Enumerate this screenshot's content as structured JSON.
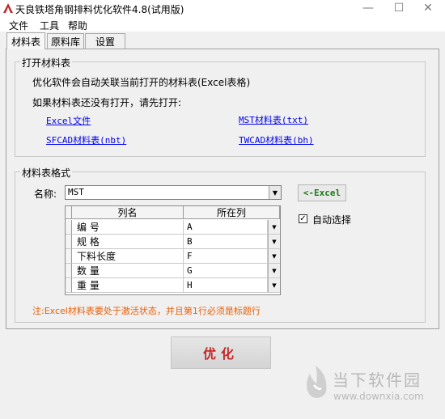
{
  "window": {
    "title": "天良铁塔角钢排料优化软件4.8(试用版)",
    "minimize_glyph": "—",
    "maximize_glyph": "☐",
    "close_glyph": "✕"
  },
  "menu": {
    "file": "文件",
    "tools": "工具",
    "help": "帮助"
  },
  "tabs": [
    {
      "label": "材料表",
      "active": true
    },
    {
      "label": "原料库",
      "active": false
    },
    {
      "label": "设置",
      "active": false
    }
  ],
  "open_group": {
    "title": "打开材料表",
    "description": "优化软件会自动关联当前打开的材料表(Excel表格)",
    "hint": "如果材料表还没有打开，请先打开:",
    "links": {
      "excel": "Excel文件",
      "mst": "MST材料表(txt)",
      "sfcad": "SFCAD材料表(nbt)",
      "twcad": "TWCAD材料表(bh)"
    }
  },
  "format_group": {
    "title": "材料表格式",
    "name_label": "名称:",
    "name_value": "MST",
    "excel_button": "<-Excel",
    "auto_select": {
      "label": "自动选择",
      "checked": true
    },
    "grid": {
      "headers": [
        "列名",
        "所在列"
      ],
      "rows": [
        {
          "name": "编  号",
          "column": "A"
        },
        {
          "name": "规  格",
          "column": "B"
        },
        {
          "name": "下料长度",
          "column": "F"
        },
        {
          "name": "数  量",
          "column": "G"
        },
        {
          "name": "重  量",
          "column": "H"
        }
      ]
    },
    "note": "注:Excel材料表要处于激活状态，并且第1行必须是标题行"
  },
  "optimize_button": "优化",
  "watermark": {
    "name": "当下软件园",
    "url": "www.downxia.com"
  },
  "colors": {
    "link": "#0000ee",
    "note": "#e8600a",
    "optimize_text": "#c0282a",
    "excel_button_text": "#1a7a1a"
  }
}
